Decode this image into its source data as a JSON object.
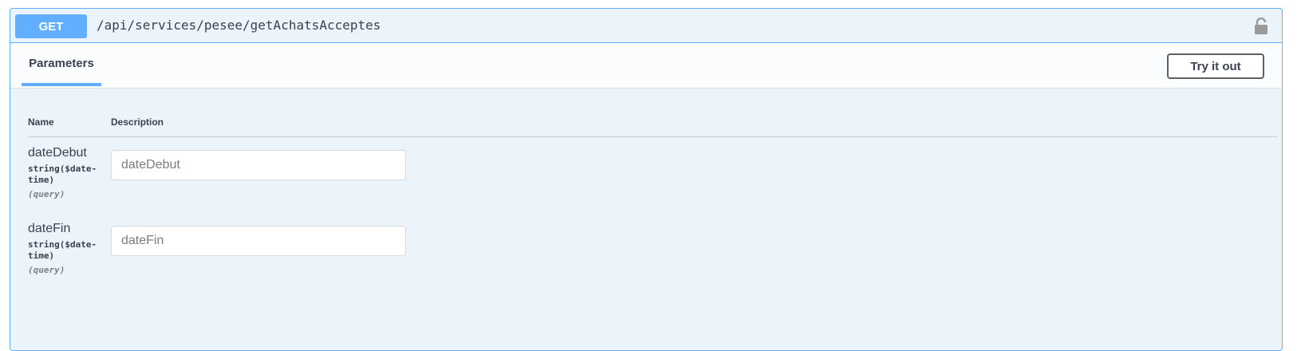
{
  "operation": {
    "method": "GET",
    "path": "/api/services/pesee/getAchatsAcceptes",
    "lock_icon": "lock-icon"
  },
  "section": {
    "tab_label": "Parameters",
    "try_button_label": "Try it out"
  },
  "table": {
    "headers": {
      "name": "Name",
      "description": "Description"
    },
    "parameters": [
      {
        "name": "dateDebut",
        "type": "string($date-time)",
        "in": "(query)",
        "value": "",
        "placeholder": "dateDebut"
      },
      {
        "name": "dateFin",
        "type": "string($date-time)",
        "in": "(query)",
        "value": "",
        "placeholder": "dateFin"
      }
    ]
  },
  "colors": {
    "accent": "#61affe",
    "block_background": "#ebf3fb"
  }
}
